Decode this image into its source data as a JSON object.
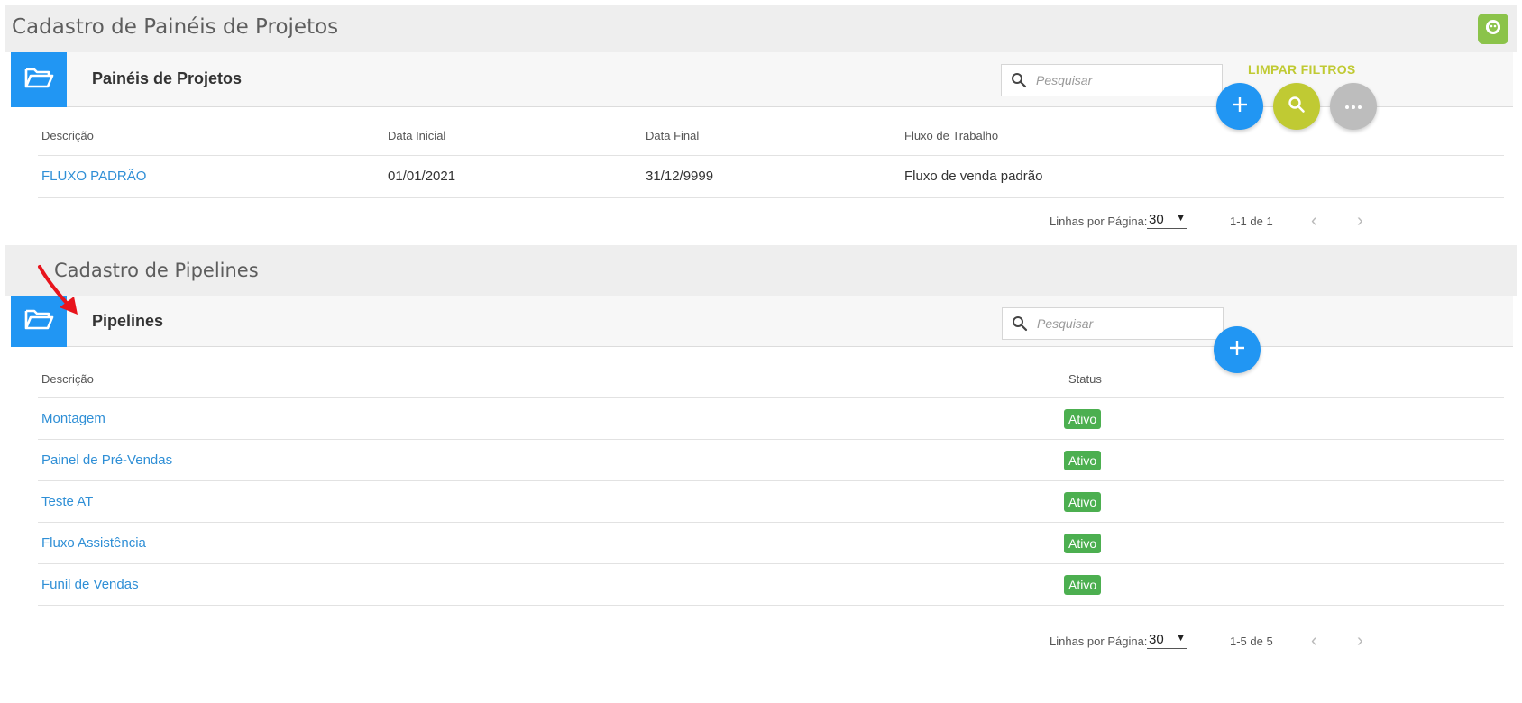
{
  "page_title": "Cadastro de Painéis de Projetos",
  "colors": {
    "primary": "#2196f3",
    "accent": "#c0ca33",
    "success": "#4caf50",
    "link": "#2f8fd6",
    "chat": "#8bc34a"
  },
  "icons": {
    "corner": "chat-bot-icon",
    "folder": "folder-open-icon",
    "search": "search-icon",
    "add": "plus-icon",
    "more": "more-horizontal-icon",
    "prev": "chevron-left-icon",
    "next": "chevron-right-icon",
    "annotation": "red-arrow-icon"
  },
  "panels": {
    "title": "Painéis de Projetos",
    "search_placeholder": "Pesquisar",
    "clear_filters": "LIMPAR FILTROS",
    "columns": [
      "Descrição",
      "Data Inicial",
      "Data Final",
      "Fluxo de Trabalho"
    ],
    "rows": [
      {
        "descricao": "FLUXO PADRÃO",
        "data_inicial": "01/01/2021",
        "data_final": "31/12/9999",
        "fluxo": "Fluxo de venda padrão"
      }
    ],
    "pager": {
      "label": "Linhas por Página:",
      "per_page": "30",
      "range": "1-1 de 1"
    }
  },
  "pipelines_section_title": "Cadastro de Pipelines",
  "pipelines": {
    "title": "Pipelines",
    "search_placeholder": "Pesquisar",
    "columns": [
      "Descrição",
      "Status"
    ],
    "rows": [
      {
        "descricao": "Montagem",
        "status": "Ativo"
      },
      {
        "descricao": "Painel de Pré-Vendas",
        "status": "Ativo"
      },
      {
        "descricao": "Teste AT",
        "status": "Ativo"
      },
      {
        "descricao": "Fluxo Assistência",
        "status": "Ativo"
      },
      {
        "descricao": "Funil de Vendas",
        "status": "Ativo"
      }
    ],
    "pager": {
      "label": "Linhas por Página:",
      "per_page": "30",
      "range": "1-5 de 5"
    }
  }
}
